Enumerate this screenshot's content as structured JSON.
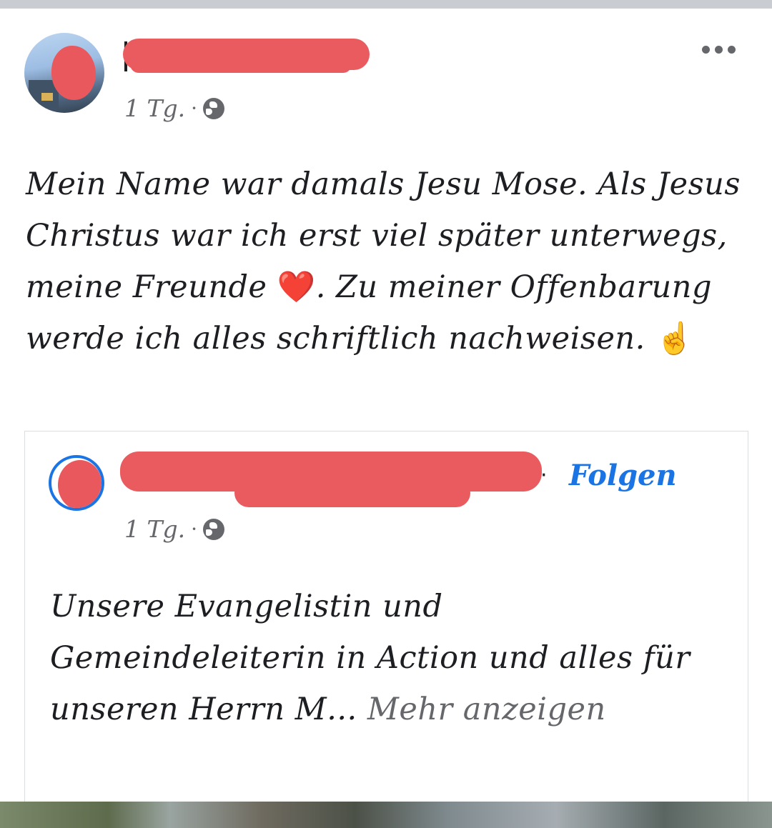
{
  "post": {
    "time": "1 Tg.",
    "separator": "·",
    "text_before_heart": "Mein Name war damals Jesu Mose. Als Jesus Christus war ich erst viel später unterwegs, meine Freunde ",
    "heart": "❤️",
    "text_after_heart": ". Zu meiner Offenbarung werde ich alles schriftlich nachweisen. ",
    "finger": "☝️",
    "more_icon": "more-options-icon",
    "audience_icon": "globe-icon"
  },
  "shared": {
    "time": "1 Tg.",
    "separator": "·",
    "name_dot": "·",
    "follow_label": "Folgen",
    "text": "Unsere Evangelistin und Gemeindeleiterin in Action und alles für unseren Herrn M... ",
    "see_more": "Mehr anzeigen",
    "audience_icon": "globe-icon"
  },
  "colors": {
    "link": "#1b74e4",
    "redaction": "#e95b5f",
    "secondary_text": "#65676b"
  }
}
